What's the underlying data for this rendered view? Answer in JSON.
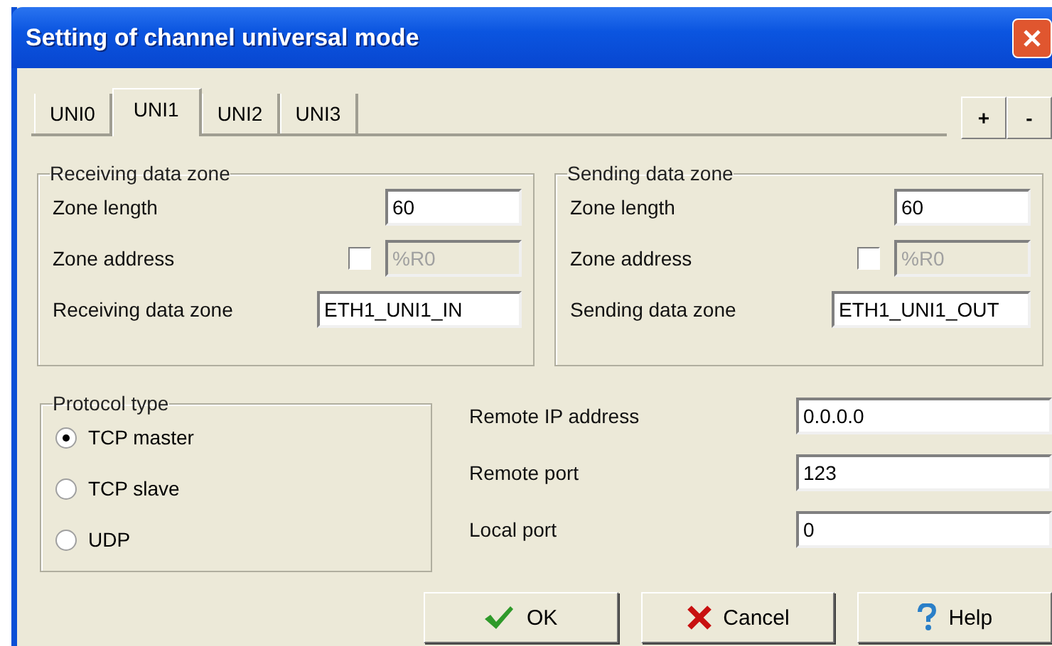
{
  "window": {
    "title": "Setting of channel universal mode"
  },
  "tabs": [
    {
      "label": "UNI0",
      "selected": false
    },
    {
      "label": "UNI1",
      "selected": true
    },
    {
      "label": "UNI2",
      "selected": false
    },
    {
      "label": "UNI3",
      "selected": false
    }
  ],
  "tab_buttons": [
    "+",
    "-"
  ],
  "zones": [
    {
      "title": "Receiving data zone",
      "length_label": "Zone length",
      "length": "60",
      "address_label": "Zone address",
      "address_checked": false,
      "address": "%R0",
      "name_label": "Receiving data zone",
      "name": "ETH1_UNI1_IN"
    },
    {
      "title": "Sending data zone",
      "length_label": "Zone length",
      "length": "60",
      "address_label": "Zone address",
      "address_checked": false,
      "address": "%R0",
      "name_label": "Sending data zone",
      "name": "ETH1_UNI1_OUT"
    }
  ],
  "protocol": {
    "title": "Protocol type",
    "options": [
      {
        "label": "TCP master",
        "selected": true
      },
      {
        "label": "TCP slave",
        "selected": false
      },
      {
        "label": "UDP",
        "selected": false
      }
    ]
  },
  "fields": [
    {
      "label": "Remote IP address",
      "value": "0.0.0.0"
    },
    {
      "label": "Remote port",
      "value": "123"
    },
    {
      "label": "Local port",
      "value": "0"
    }
  ],
  "buttons": [
    {
      "kind": "ok",
      "label": "OK"
    },
    {
      "kind": "cancel",
      "label": "Cancel"
    },
    {
      "kind": "help",
      "label": "Help"
    }
  ]
}
